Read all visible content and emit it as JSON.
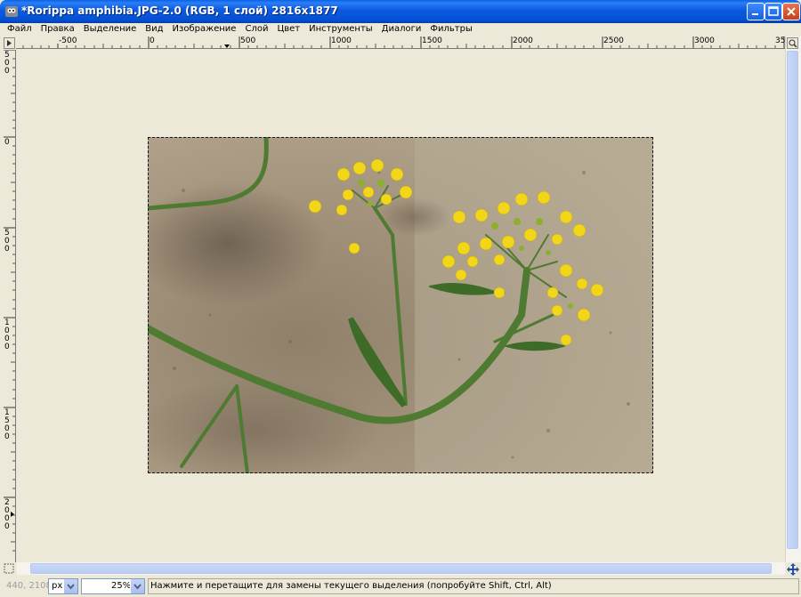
{
  "window": {
    "title": "*Rorippa amphibia.JPG-2.0 (RGB, 1 слой) 2816x1877"
  },
  "menu": [
    "Файл",
    "Правка",
    "Выделение",
    "Вид",
    "Изображение",
    "Слой",
    "Цвет",
    "Инструменты",
    "Диалоги",
    "Фильтры"
  ],
  "rulers": {
    "horizontal": [
      "-500",
      "0",
      "500",
      "1000",
      "1500",
      "2000",
      "2500",
      "3000",
      "35"
    ],
    "vertical": [
      "500",
      "0",
      "500",
      "1000",
      "1500",
      "2000"
    ]
  },
  "status": {
    "coords": "440, 2108",
    "unit": "px",
    "zoom": "25%",
    "message": "Нажмите и перетащите для замены текущего выделения (попробуйте Shift, Ctrl, Alt)"
  },
  "colors": {
    "titlebar": "#0a5ae0",
    "canvas": "#ece9d8",
    "flower": "#f2d61a",
    "stem": "#4f7a32",
    "sand": "#a89c86"
  }
}
